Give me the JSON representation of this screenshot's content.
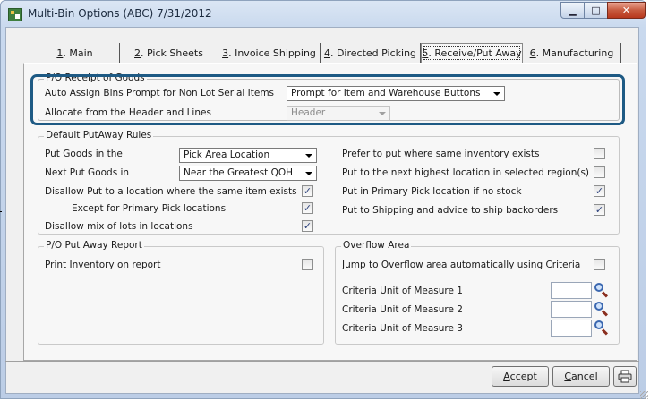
{
  "window": {
    "title": "Multi-Bin Options (ABC) 7/31/2012",
    "minimize_glyph": "▁",
    "maximize_glyph": "□",
    "close_glyph": "✕"
  },
  "tabs": [
    {
      "key": "1",
      "rest": ". Main"
    },
    {
      "key": "2",
      "rest": ". Pick Sheets"
    },
    {
      "key": "3",
      "rest": ". Invoice Shipping"
    },
    {
      "key": "4",
      "rest": ". Directed Picking"
    },
    {
      "key": "5",
      "rest": ". Receive/Put Away"
    },
    {
      "key": "6",
      "rest": ". Manufacturing"
    }
  ],
  "receipt": {
    "title": "P/O Receipt of Goods",
    "auto_assign_label": "Auto Assign Bins Prompt for Non Lot Serial Items",
    "auto_assign_value": "Prompt for Item and Warehouse Buttons",
    "allocate_label": "Allocate from the Header and Lines",
    "allocate_value": "Header"
  },
  "putaway": {
    "title": "Default PutAway Rules",
    "put_goods_label": "Put Goods in the",
    "put_goods_value": "Pick Area Location",
    "next_put_label": "Next Put Goods in",
    "next_put_value": "Near the Greatest QOH",
    "disallow_same_label": "Disallow Put to a location where the same item exists",
    "except_primary_label": "Except for Primary Pick locations",
    "disallow_mix_label": "Disallow mix of lots in locations",
    "prefer_same_label": "Prefer to put where same inventory exists",
    "next_highest_label": "Put to the next highest location in selected region(s)",
    "primary_pick_label": "Put in Primary Pick location if no stock",
    "shipping_label": "Put to Shipping and advice to ship backorders",
    "checks": {
      "disallow_same": true,
      "except_primary": true,
      "disallow_mix": true,
      "prefer_same": false,
      "next_highest": false,
      "primary_pick": true,
      "shipping": true
    }
  },
  "report": {
    "title": "P/O Put Away Report",
    "print_label": "Print Inventory on report",
    "print_checked": false
  },
  "overflow": {
    "title": "Overflow Area",
    "jump_label": "Jump to Overflow area automatically using Criteria",
    "jump_checked": false,
    "criteria1_label": "Criteria Unit of Measure 1",
    "criteria2_label": "Criteria Unit of Measure 2",
    "criteria3_label": "Criteria Unit of Measure 3"
  },
  "buttons": {
    "accept_key": "A",
    "accept_rest": "ccept",
    "cancel_key": "C",
    "cancel_rest": "ancel"
  },
  "check_glyph": "✓",
  "colors": {
    "highlight": "#1e5a84",
    "check": "#2a3f7a"
  }
}
